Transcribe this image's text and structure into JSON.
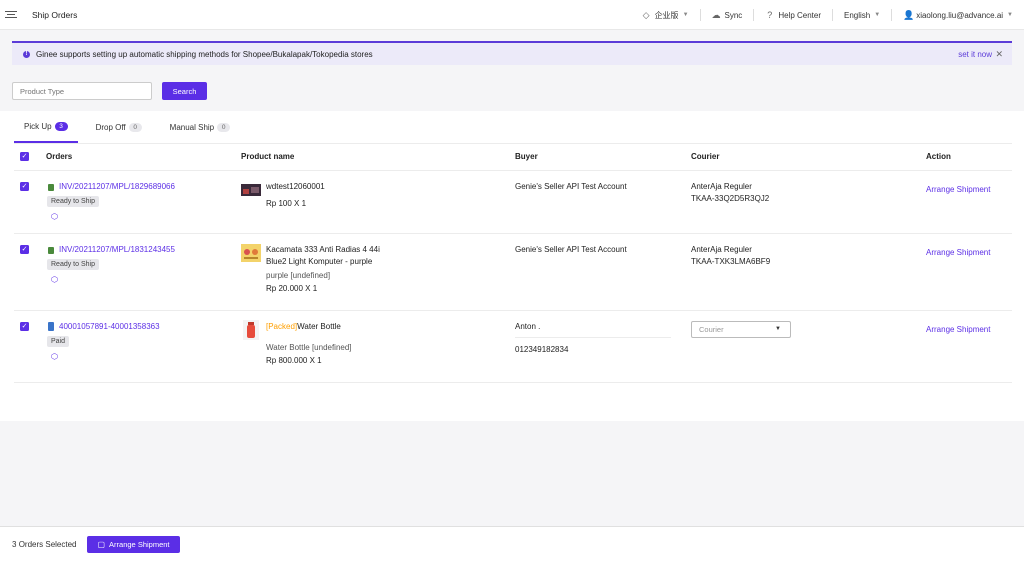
{
  "header": {
    "title": "Ship Orders",
    "edition": "企业版",
    "sync": "Sync",
    "help": "Help Center",
    "language": "English",
    "user": "xiaolong.liu@advance.ai"
  },
  "banner": {
    "text": "Ginee supports setting up automatic shipping methods for Shopee/Bukalapak/Tokopedia stores",
    "link": "set it now",
    "close": "✕"
  },
  "search": {
    "placeholder": "Product Type",
    "button": "Search"
  },
  "tabs": [
    {
      "label": "Pick Up",
      "count": "3"
    },
    {
      "label": "Drop Off",
      "count": "0"
    },
    {
      "label": "Manual Ship",
      "count": "0"
    }
  ],
  "columns": {
    "orders": "Orders",
    "product": "Product name",
    "buyer": "Buyer",
    "courier": "Courier",
    "action": "Action"
  },
  "rows": [
    {
      "order_id": "INV/20211207/MPL/1829689066",
      "status": "Ready to Ship",
      "product_name": "wdtest12060001",
      "price": "Rp 100 X 1",
      "buyer": "Genie's Seller API Test Account",
      "courier": "AnterAja Reguler",
      "tracking": "TKAA-33Q2D5R3QJ2",
      "action": "Arrange Shipment"
    },
    {
      "order_id": "INV/20211207/MPL/1831243455",
      "status": "Ready to Ship",
      "product_name_line1": "Kacamata 333 Anti Radias 4 44i",
      "product_name_line2": "Blue2 Light Komputer - purple",
      "variant": "purple [undefined]",
      "price": "Rp 20.000 X 1",
      "buyer": "Genie's Seller API Test Account",
      "courier": "AnterAja Reguler",
      "tracking": "TKAA-TXK3LMA6BF9",
      "action": "Arrange Shipment"
    },
    {
      "order_id": "40001057891-40001358363",
      "status": "Paid",
      "packed_tag": "[Packed]",
      "product_name": "Water Bottle",
      "variant": "Water Bottle [undefined]",
      "price": "Rp 800.000 X 1",
      "buyer": "Anton .",
      "phone": "012349182834",
      "courier_placeholder": "Courier",
      "action": "Arrange Shipment"
    }
  ],
  "footer": {
    "selected_count": "3",
    "selected_label": "Orders Selected",
    "button": "Arrange Shipment"
  },
  "colors": {
    "accent": "#5b2ee6",
    "packed": "#ff9f00"
  }
}
